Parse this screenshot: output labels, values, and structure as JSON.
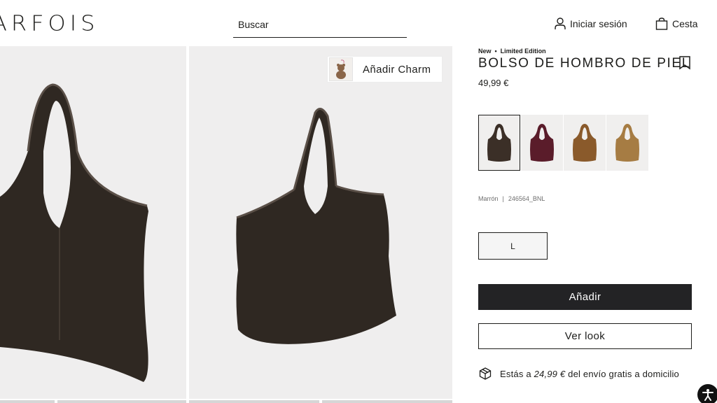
{
  "header": {
    "logo": "ARFOIS",
    "search_placeholder": "Buscar",
    "login_label": "Iniciar sesión",
    "login_icon": "user-icon",
    "cart_label": "Cesta",
    "cart_icon": "bag-icon"
  },
  "gallery": {
    "charm_label": "Añadir Charm"
  },
  "product": {
    "tag_new": "New",
    "tag_separator": "•",
    "tag_limited": "Limited Edition",
    "title": "BOLSO DE HOMBRO DE PIEL",
    "price": "49,99 €",
    "colors": [
      {
        "name": "Marrón oscuro",
        "hex": "#3b2f27",
        "selected": true
      },
      {
        "name": "Burdeos",
        "hex": "#5a1c2a",
        "selected": false
      },
      {
        "name": "Cuero",
        "hex": "#8a5a2b",
        "selected": false
      },
      {
        "name": "Camel",
        "hex": "#a67c43",
        "selected": false
      }
    ],
    "color_name": "Marrón",
    "ref_separator": "|",
    "reference": "246564_BNL",
    "size": "L",
    "add_button": "Añadir",
    "look_button": "Ver look"
  },
  "shipping": {
    "prefix": "Estás a",
    "amount": "24,99 €",
    "suffix": "del envío gratis a domicilio",
    "icon": "package-icon"
  },
  "colors": {
    "text": "#1d1d1b",
    "button_dark": "#232325",
    "image_bg": "#efeeee",
    "bag_main": "#2f2822"
  }
}
